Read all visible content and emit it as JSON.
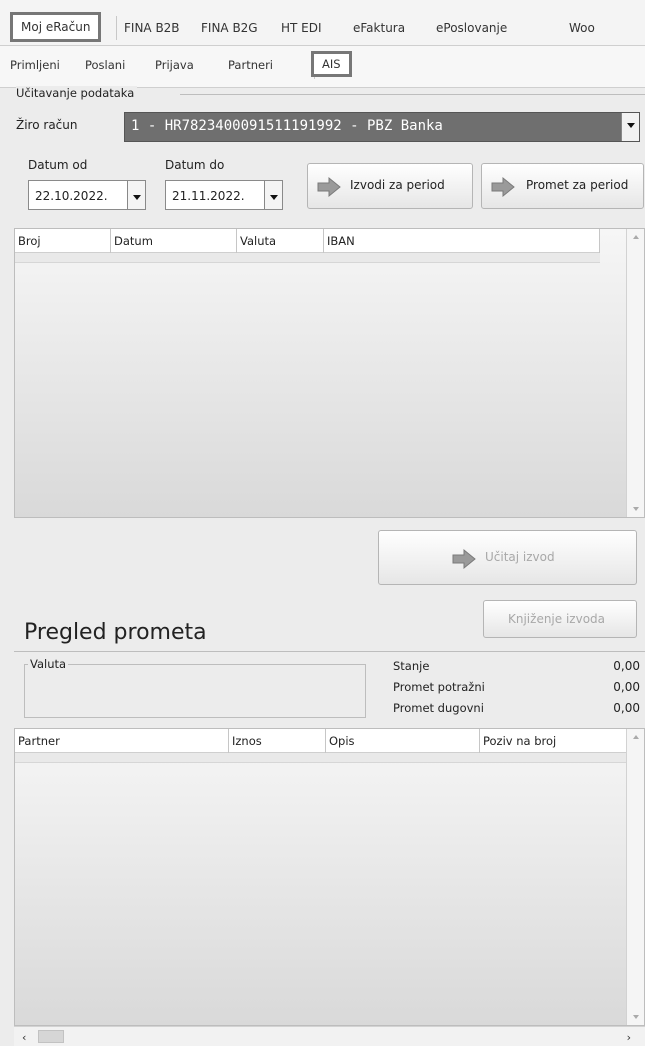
{
  "top_tabs": [
    "Moj eRačun",
    "FINA B2B",
    "FINA B2G",
    "HT EDI",
    "eFaktura",
    "ePoslovanje",
    "Woo"
  ],
  "sub_tabs": [
    "Primljeni",
    "Poslani",
    "Prijava",
    "Partneri",
    "AIS"
  ],
  "load_section": {
    "group_title": "Učitavanje podataka",
    "account_label": "Žiro račun",
    "account_value": "1 - HR7823400091511191992 - PBZ Banka",
    "date_from_label": "Datum od",
    "date_from_value": "22.10.2022.",
    "date_to_label": "Datum do",
    "date_to_value": "21.11.2022.",
    "statements_button": "Izvodi za period",
    "turnover_button": "Promet za period"
  },
  "statements_grid": {
    "columns": [
      "Broj",
      "Datum",
      "Valuta",
      "IBAN"
    ]
  },
  "load_statement_button": "Učitaj izvod",
  "turnover": {
    "title": "Pregled prometa",
    "book_button": "Knjiženje izvoda",
    "currency_group": "Valuta",
    "summary": [
      {
        "label": "Stanje",
        "value": "0,00"
      },
      {
        "label": "Promet potražni",
        "value": "0,00"
      },
      {
        "label": "Promet dugovni",
        "value": "0,00"
      }
    ]
  },
  "turnover_grid": {
    "columns": [
      "Partner",
      "Iznos",
      "Opis",
      "Poziv na broj"
    ]
  },
  "colors": {
    "highlight_border": "#777777",
    "combo_background": "#6f6f6f"
  }
}
